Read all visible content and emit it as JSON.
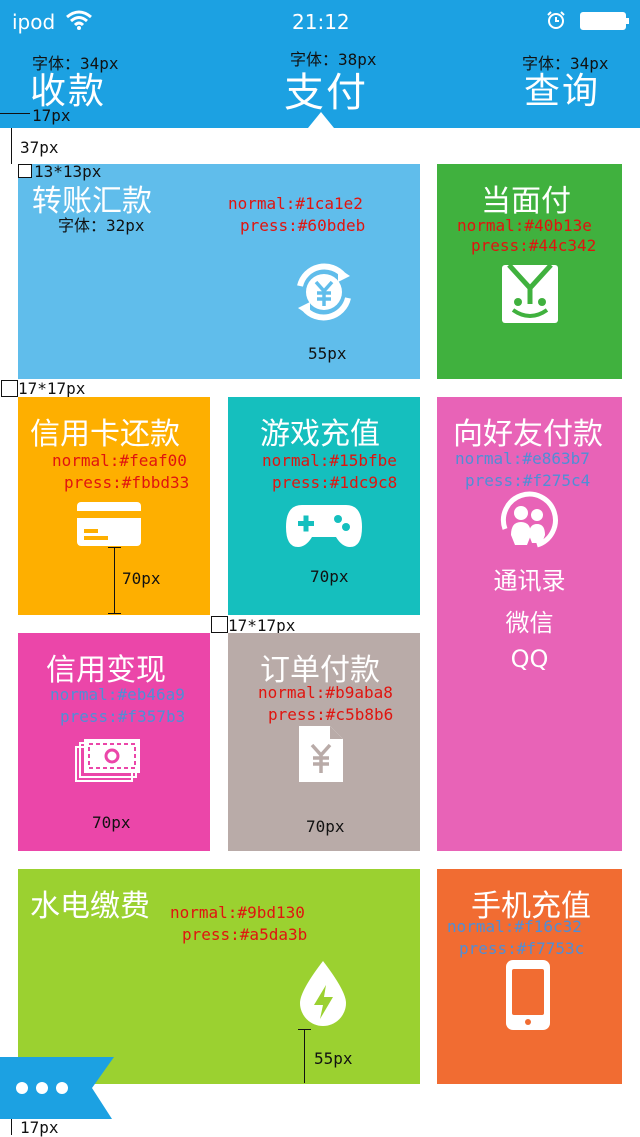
{
  "status_bar": {
    "carrier": "ipod",
    "time": "21:12"
  },
  "tabs": [
    {
      "label": "收款",
      "note": "字体：34px"
    },
    {
      "label": "支付",
      "note": "字体：38px"
    },
    {
      "label": "查询",
      "note": "字体：34px"
    }
  ],
  "annotations": {
    "gap_17": "17px",
    "gap_37": "37px",
    "box_13": "13*13px",
    "box_17": "17*17px",
    "box_17b": "17*17px",
    "bottom_17": "17px"
  },
  "tiles": {
    "transfer": {
      "title": "转账汇款",
      "font_note": "字体：32px",
      "normal": "normal:#1ca1e2",
      "press": "press:#60bdeb",
      "icon_size": "55px",
      "color": "#60bdeb"
    },
    "face_pay": {
      "title": "当面付",
      "normal": "normal:#40b13e",
      "press": "press:#44c342",
      "color": "#40b13e"
    },
    "credit_repay": {
      "title": "信用卡还款",
      "normal": "normal:#feaf00",
      "press": "press:#fbbd33",
      "icon_size": "70px",
      "color": "#feaf00"
    },
    "game": {
      "title": "游戏充值",
      "normal": "normal:#15bfbe",
      "press": "press:#1dc9c8",
      "icon_size": "70px",
      "color": "#15bfbe"
    },
    "friend_pay": {
      "title": "向好友付款",
      "normal": "normal:#e863b7",
      "press": "press:#f275c4",
      "color": "#e863b7",
      "items": [
        "通讯录",
        "微信",
        "QQ"
      ]
    },
    "credit_cash": {
      "title": "信用变现",
      "normal": "normal:#eb46a9",
      "press": "press:#f357b3",
      "icon_size": "70px",
      "color": "#eb46a9"
    },
    "order_pay": {
      "title": "订单付款",
      "normal": "normal:#b9aba8",
      "press": "press:#c5b8b6",
      "icon_size": "70px",
      "color": "#b9aba8"
    },
    "utility": {
      "title": "水电缴费",
      "normal": "normal:#9bd130",
      "press": "press:#a5da3b",
      "icon_size": "55px",
      "color": "#9bd130"
    },
    "phone": {
      "title": "手机充值",
      "normal": "normal:#f16c32",
      "press": "press:#f7753c",
      "color": "#f16c32"
    }
  },
  "icons": {
    "wifi": "wifi-icon",
    "alarm": "alarm-icon",
    "battery": "battery-icon",
    "yuan_cycle": "yuan-refresh-icon",
    "qr_face": "face-pay-icon",
    "card": "credit-card-icon",
    "gamepad": "gamepad-icon",
    "friends": "friends-icon",
    "cash": "cash-icon",
    "receipt": "receipt-icon",
    "water": "water-drop-icon",
    "phone": "phone-icon",
    "more": "more-icon"
  }
}
